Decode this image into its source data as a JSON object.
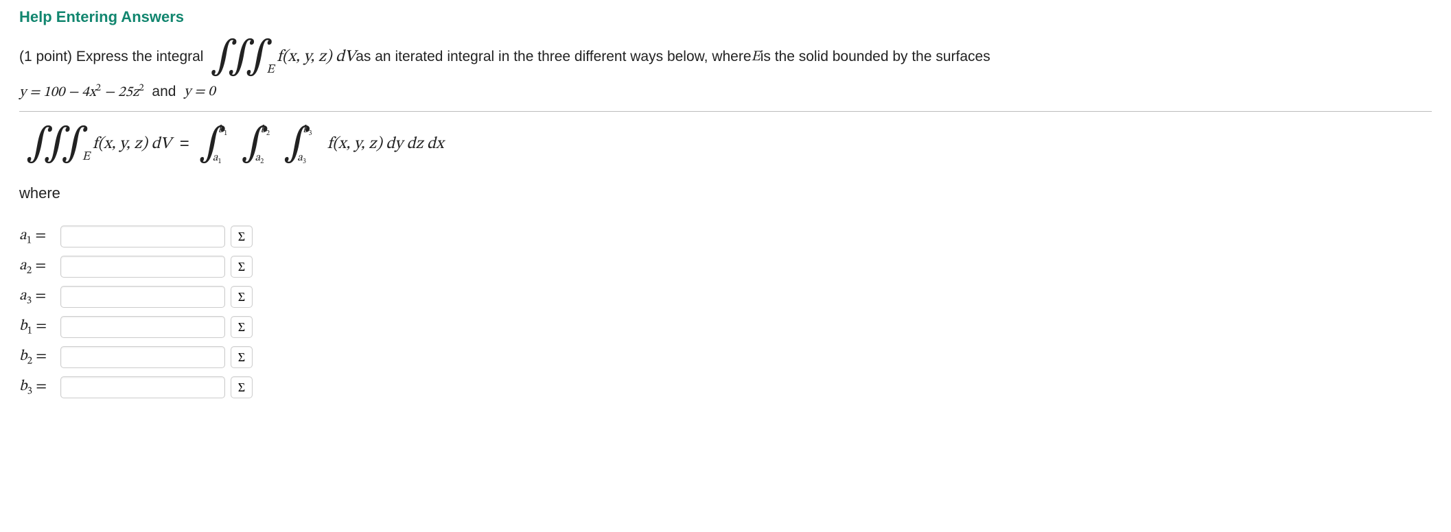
{
  "help_link": "Help Entering Answers",
  "prompt": {
    "prefix": "(1 point) Express the integral ",
    "integrand": "f(x, y, z) dV",
    "region": "E",
    "mid": " as an iterated integral in the three different ways below, where ",
    "region_ref": "E",
    "suffix": " is the solid bounded by the surfaces",
    "surface1_prefix": "y = 100 − 4x",
    "surface1_exp1": "2",
    "surface1_mid": " − 25z",
    "surface1_exp2": "2",
    "surface1_and": "  and  ",
    "surface2": "y = 0"
  },
  "equation": {
    "lhs_integrand": "f(x, y, z) dV",
    "lhs_region": "E",
    "eq": "=",
    "bounds": [
      {
        "lo": "a",
        "losub": "1",
        "hi": "b",
        "hisub": "1"
      },
      {
        "lo": "a",
        "losub": "2",
        "hi": "b",
        "hisub": "2"
      },
      {
        "lo": "a",
        "losub": "3",
        "hi": "b",
        "hisub": "3"
      }
    ],
    "rhs_integrand": "f(x, y, z) dy dz dx"
  },
  "where": "where",
  "fields": [
    {
      "var": "a",
      "sub": "1",
      "eq": "=",
      "value": "",
      "sigma": "Σ"
    },
    {
      "var": "a",
      "sub": "2",
      "eq": "=",
      "value": "",
      "sigma": "Σ"
    },
    {
      "var": "a",
      "sub": "3",
      "eq": "=",
      "value": "",
      "sigma": "Σ"
    },
    {
      "var": "b",
      "sub": "1",
      "eq": "=",
      "value": "",
      "sigma": "Σ"
    },
    {
      "var": "b",
      "sub": "2",
      "eq": "=",
      "value": "",
      "sigma": "Σ"
    },
    {
      "var": "b",
      "sub": "3",
      "eq": "=",
      "value": "",
      "sigma": "Σ"
    }
  ]
}
